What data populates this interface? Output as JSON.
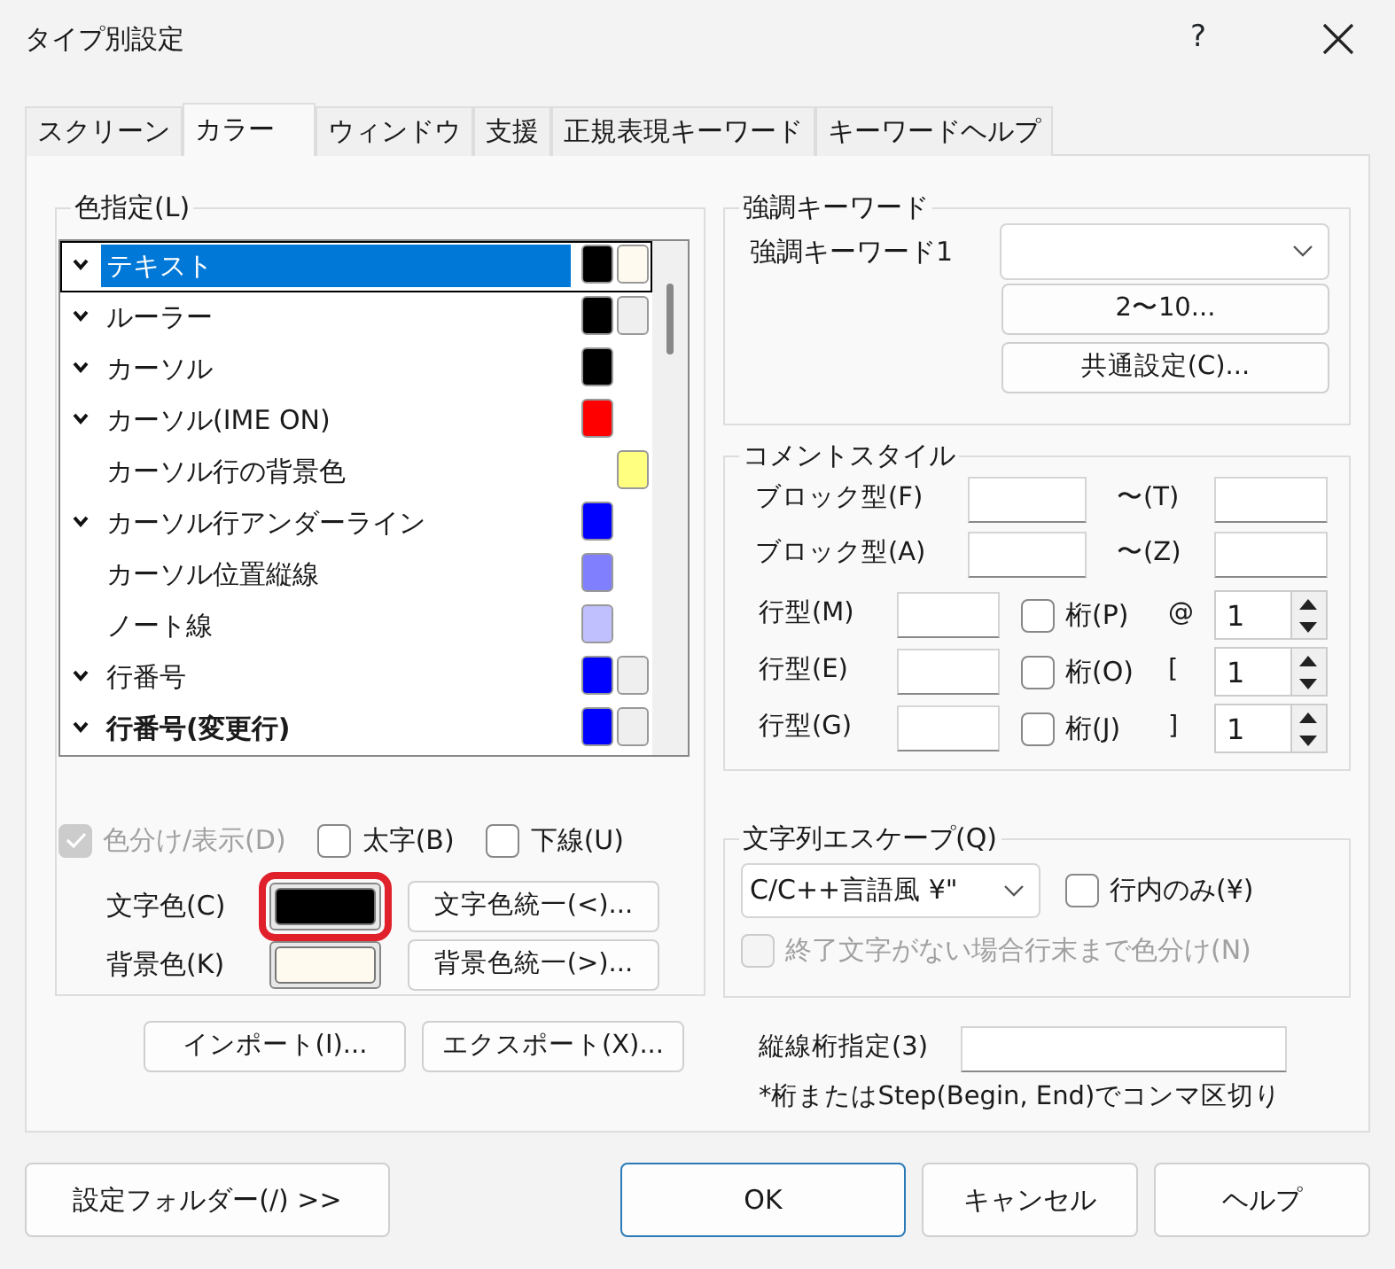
{
  "window": {
    "title": "タイプ別設定",
    "help": "?"
  },
  "tabs": [
    {
      "label": "スクリーン",
      "selected": false
    },
    {
      "label": "カラー",
      "selected": true
    },
    {
      "label": "ウィンドウ",
      "selected": false
    },
    {
      "label": "支援",
      "selected": false
    },
    {
      "label": "正規表現キーワード",
      "selected": false
    },
    {
      "label": "キーワードヘルプ",
      "selected": false
    }
  ],
  "color_list": {
    "title": "色指定(L)",
    "items": [
      {
        "label": "テキスト",
        "enabled": true,
        "bold": false,
        "selected": true,
        "text_swatch": {
          "color": "#000000"
        },
        "back_swatch": {
          "color": "#fffaf0"
        }
      },
      {
        "label": "ルーラー",
        "enabled": true,
        "bold": false,
        "selected": false,
        "text_swatch": {
          "color": "#000000"
        },
        "back_swatch": {
          "color": "#efefef"
        }
      },
      {
        "label": "カーソル",
        "enabled": true,
        "bold": false,
        "selected": false,
        "text_swatch": {
          "color": "#000000"
        }
      },
      {
        "label": "カーソル(IME ON)",
        "enabled": true,
        "bold": false,
        "selected": false,
        "text_swatch": {
          "color": "#ff0000"
        }
      },
      {
        "label": "カーソル行の背景色",
        "enabled": false,
        "bold": false,
        "selected": false,
        "back_swatch": {
          "color": "#ffff80"
        }
      },
      {
        "label": "カーソル行アンダーライン",
        "enabled": true,
        "bold": false,
        "selected": false,
        "text_swatch": {
          "color": "#0000ff"
        }
      },
      {
        "label": "カーソル位置縦線",
        "enabled": false,
        "bold": false,
        "selected": false,
        "text_swatch": {
          "color": "#8080ff"
        }
      },
      {
        "label": "ノート線",
        "enabled": false,
        "bold": false,
        "selected": false,
        "text_swatch": {
          "color": "#c0c0ff"
        }
      },
      {
        "label": "行番号",
        "enabled": true,
        "bold": false,
        "selected": false,
        "text_swatch": {
          "color": "#0000ff"
        },
        "back_swatch": {
          "color": "#efefef"
        }
      },
      {
        "label": "行番号(変更行)",
        "enabled": true,
        "bold": true,
        "selected": false,
        "text_swatch": {
          "color": "#0000ff"
        },
        "back_swatch": {
          "color": "#efefef"
        }
      }
    ],
    "options": [
      {
        "label": "色分け/表示(D)",
        "checked": true,
        "disabled": true
      },
      {
        "label": "太字(B)",
        "checked": false,
        "disabled": false
      },
      {
        "label": "下線(U)",
        "checked": false,
        "disabled": false
      }
    ],
    "text_color": {
      "label": "文字色(C)",
      "color": "#000000",
      "highlighted": true,
      "button": "文字色統一(<)..."
    },
    "background_color": {
      "label": "背景色(K)",
      "color": "#fffaf0",
      "highlighted": false,
      "button": "背景色統一(>)..."
    }
  },
  "import_export": [
    "インポート(I)...",
    "エクスポート(X)..."
  ],
  "keywords": {
    "title": "強調キーワード",
    "label": "強調キーワード1",
    "buttons": [
      "2〜10...",
      "共通設定(C)..."
    ]
  },
  "comment_style": {
    "title": "コメントスタイル",
    "block": [
      {
        "label": "ブロック型(F)",
        "to_label": "〜(T)"
      },
      {
        "label": "ブロック型(A)",
        "to_label": "〜(Z)"
      }
    ],
    "line": [
      {
        "label": "行型(M)",
        "column_label": "桁(P)",
        "checked": false,
        "prefix": "@",
        "value": "1"
      },
      {
        "label": "行型(E)",
        "column_label": "桁(O)",
        "checked": false,
        "prefix": "[",
        "value": "1"
      },
      {
        "label": "行型(G)",
        "column_label": "桁(J)",
        "checked": false,
        "prefix": "]",
        "value": "1"
      }
    ]
  },
  "string_escape": {
    "title": "文字列エスケープ(Q)",
    "value": "C/C++言語風 ¥\"",
    "options": [
      {
        "label": "行内のみ(¥)",
        "checked": false,
        "disabled": false
      },
      {
        "label": "終了文字がない場合行末まで色分け(N)",
        "checked": false,
        "disabled": true
      }
    ]
  },
  "vertical_lines": {
    "label": "縦線桁指定(3)",
    "note": "*桁またはStep(Begin, End)でコンマ区切り"
  },
  "footer": [
    {
      "label": "設定フォルダー(/) >>",
      "default": false
    },
    {
      "label": "OK",
      "default": true
    },
    {
      "label": "キャンセル",
      "default": false
    },
    {
      "label": "ヘルプ",
      "default": false
    }
  ]
}
